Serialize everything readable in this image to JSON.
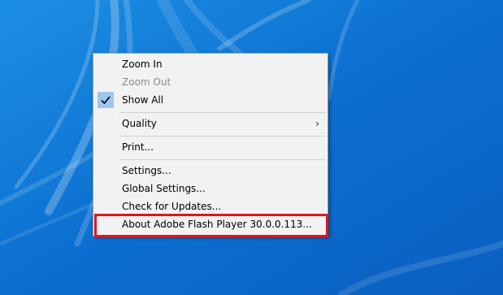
{
  "menu": {
    "zoom_in": "Zoom In",
    "zoom_out": "Zoom Out",
    "show_all": "Show All",
    "quality": "Quality",
    "quality_arrow": "›",
    "print": "Print...",
    "settings": "Settings...",
    "global_settings": "Global Settings...",
    "check_updates": "Check for Updates...",
    "about": "About Adobe Flash Player 30.0.0.113..."
  },
  "colors": {
    "desktop": "#0a6fcf",
    "menu_bg": "#f2f2f2",
    "check_bg": "#9cc7ee",
    "highlight_border": "#e0161f"
  },
  "icons": {
    "show_all_state": "checkmark-icon",
    "quality_submenu": "chevron-right-icon"
  }
}
